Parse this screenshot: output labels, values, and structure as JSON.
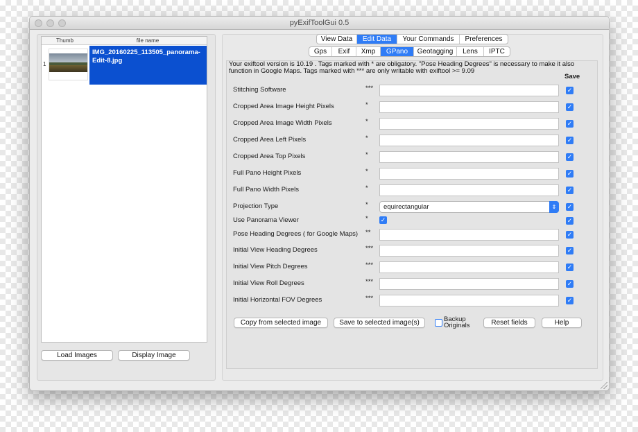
{
  "window": {
    "title": "pyExifToolGui 0.5"
  },
  "image_list": {
    "headers": [
      "Thumb",
      "file name"
    ],
    "rows": [
      {
        "index": "1",
        "filename": "IMG_20160225_113505_panorama-Edit-8.jpg"
      }
    ]
  },
  "left_buttons": {
    "load": "Load Images",
    "display": "Display Image"
  },
  "main_tabs": [
    "View Data",
    "Edit Data",
    "Your Commands",
    "Preferences"
  ],
  "main_tab_active": "Edit Data",
  "sub_tabs": [
    "Gps",
    "Exif",
    "Xmp",
    "GPano",
    "Geotagging",
    "Lens",
    "IPTC"
  ],
  "sub_tab_active": "GPano",
  "info_text": "Your exiftool version is 10.19 . Tags marked with * are obligatory. \"Pose Heading Degrees\" is necessary to make it also function in Google Maps. Tags marked with *** are only writable with exiftool >= 9.09",
  "save_header": "Save",
  "fields": [
    {
      "label": "Stitching Software",
      "marker": "***",
      "type": "text",
      "value": "",
      "save": true
    },
    {
      "label": "Cropped Area Image Height Pixels",
      "marker": "*",
      "type": "text",
      "value": "",
      "save": true
    },
    {
      "label": "Cropped Area Image Width Pixels",
      "marker": "*",
      "type": "text",
      "value": "",
      "save": true
    },
    {
      "label": "Cropped Area Left Pixels",
      "marker": "*",
      "type": "text",
      "value": "",
      "save": true
    },
    {
      "label": "Cropped Area Top Pixels",
      "marker": "*",
      "type": "text",
      "value": "",
      "save": true
    },
    {
      "label": "Full Pano Height Pixels",
      "marker": "*",
      "type": "text",
      "value": "",
      "save": true
    },
    {
      "label": "Full Pano Width Pixels",
      "marker": "*",
      "type": "text",
      "value": "",
      "save": true
    },
    {
      "label": "Projection Type",
      "marker": "*",
      "type": "select",
      "value": "equirectangular",
      "save": true
    },
    {
      "label": "Use Panorama Viewer",
      "marker": "*",
      "type": "checkbox",
      "checked": true,
      "save": true
    },
    {
      "label": "Pose Heading Degrees ( for Google Maps)",
      "marker": "**",
      "type": "text",
      "value": "",
      "save": true
    },
    {
      "label": "Initial View Heading Degrees",
      "marker": "***",
      "type": "text",
      "value": "",
      "save": true
    },
    {
      "label": "Initial View Pitch Degrees",
      "marker": "***",
      "type": "text",
      "value": "",
      "save": true
    },
    {
      "label": "Initial View Roll Degrees",
      "marker": "***",
      "type": "text",
      "value": "",
      "save": true
    },
    {
      "label": "Initial Horizontal FOV Degrees",
      "marker": "***",
      "type": "text",
      "value": "",
      "save": true
    }
  ],
  "bottom_buttons": {
    "copy": "Copy from selected image",
    "save": "Save to selected image(s)",
    "backup_line1": "Backup",
    "backup_line2": "Originals",
    "backup_checked": false,
    "reset": "Reset fields",
    "help": "Help"
  },
  "colors": {
    "accent": "#2f7cf6",
    "selection": "#0b50d0",
    "window_bg": "#ececec"
  }
}
